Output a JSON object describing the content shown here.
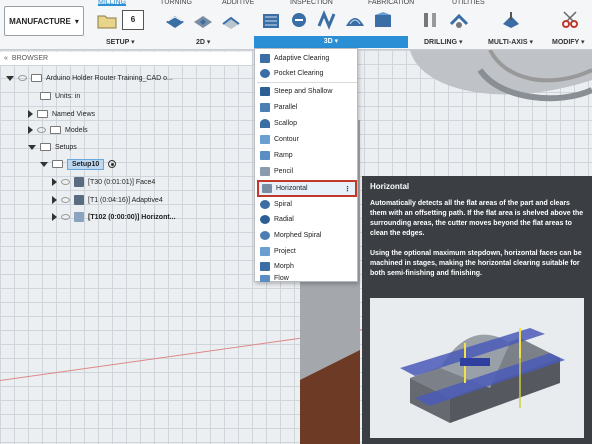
{
  "toolbar": {
    "workspace_label": "MANUFACTURE",
    "tabs": [
      "MILLING",
      "TURNING",
      "ADDITIVE",
      "INSPECTION",
      "FABRICATION",
      "UTILITIES"
    ],
    "groups": [
      "SETUP",
      "2D",
      "3D",
      "DRILLING",
      "MULTI-AXIS",
      "MODIFY"
    ],
    "setup_icon_number": "6"
  },
  "browser": {
    "header": "BROWSER",
    "document_name": "Arduino Holder Router Training_CAD o...",
    "units": "Units: in",
    "named_views": "Named Views",
    "models": "Models",
    "setups": "Setups",
    "setup_name": "Setup10",
    "operations": [
      "[T30 (0:01:01)] Face4",
      "[T1 (0:04:16)] Adaptive4",
      "[T102 (0:00:00)] Horizont..."
    ]
  },
  "menu_3d": {
    "items": [
      {
        "label": "Adaptive Clearing",
        "icon": "adaptive-clearing-icon"
      },
      {
        "label": "Pocket Clearing",
        "icon": "pocket-clearing-icon"
      },
      {
        "label": "Steep and Shallow",
        "icon": "steep-shallow-icon"
      },
      {
        "label": "Parallel",
        "icon": "parallel-icon"
      },
      {
        "label": "Scallop",
        "icon": "scallop-icon"
      },
      {
        "label": "Contour",
        "icon": "contour-icon"
      },
      {
        "label": "Ramp",
        "icon": "ramp-icon"
      },
      {
        "label": "Pencil",
        "icon": "pencil-icon"
      },
      {
        "label": "Horizontal",
        "icon": "horizontal-icon"
      },
      {
        "label": "Spiral",
        "icon": "spiral-icon"
      },
      {
        "label": "Radial",
        "icon": "radial-icon"
      },
      {
        "label": "Morphed Spiral",
        "icon": "morphed-spiral-icon"
      },
      {
        "label": "Project",
        "icon": "project-icon"
      },
      {
        "label": "Morph",
        "icon": "morph-icon"
      },
      {
        "label": "Flow",
        "icon": "flow-icon"
      }
    ],
    "more_label": "⋮"
  },
  "tooltip": {
    "title": "Horizontal",
    "paragraph1": "Automatically detects all the flat areas of the part and clears them with an offsetting path. If the flat area is shelved above the surrounding areas, the cutter moves beyond the flat areas to clean the edges.",
    "paragraph2": "Using the optional maximum stepdown, horizontal faces can be machined in stages, making the horizontal clearing suitable for both semi-finishing and finishing."
  },
  "colors": {
    "accent": "#2b8fd6",
    "highlight_border": "#c0392b",
    "tooltip_bg": "#3b3f44"
  }
}
